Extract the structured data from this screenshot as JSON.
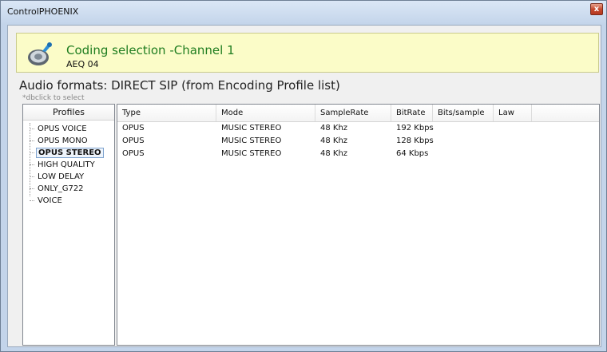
{
  "window": {
    "title": "ControlPHOENIX",
    "close_label": "x"
  },
  "header": {
    "title": "Coding selection -Channel 1",
    "subtitle": "AEQ 04"
  },
  "formats_title": "Audio formats: DIRECT SIP (from Encoding Profile list)",
  "hint": "*dbclick to select",
  "profiles": {
    "header": "Profiles",
    "items": [
      "OPUS VOICE",
      "OPUS MONO",
      "OPUS STEREO",
      "HIGH QUALITY",
      "LOW DELAY",
      "ONLY_G722",
      "VOICE"
    ],
    "selected": "OPUS STEREO"
  },
  "table": {
    "columns": [
      "Type",
      "Mode",
      "SampleRate",
      "BitRate",
      "Bits/sample",
      "Law"
    ],
    "rows": [
      [
        "OPUS",
        "MUSIC STEREO",
        "48 Khz",
        "192 Kbps",
        "",
        ""
      ],
      [
        "OPUS",
        "MUSIC STEREO",
        "48 Khz",
        "128 Kbps",
        "",
        ""
      ],
      [
        "OPUS",
        "MUSIC STEREO",
        "48 Khz",
        "64 Kbps",
        "",
        ""
      ]
    ]
  }
}
